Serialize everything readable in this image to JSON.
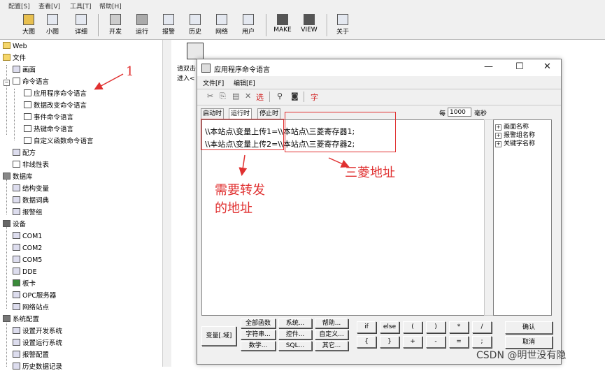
{
  "menubar": {
    "items": [
      "配置[S]",
      "查看[V]",
      "工具[T]",
      "帮助[H]"
    ]
  },
  "toolbar": {
    "buttons": [
      {
        "label": "大图",
        "icon": "large-icons-icon"
      },
      {
        "label": "小图",
        "icon": "small-icons-icon"
      },
      {
        "label": "详细",
        "icon": "details-icon"
      },
      {
        "label": "开发",
        "icon": "develop-icon"
      },
      {
        "label": "运行",
        "icon": "run-icon"
      },
      {
        "label": "报警",
        "icon": "alarm-icon"
      },
      {
        "label": "历史",
        "icon": "history-icon"
      },
      {
        "label": "网络",
        "icon": "network-icon"
      },
      {
        "label": "用户",
        "icon": "user-icon"
      },
      {
        "label": "MAKE",
        "icon": "make-icon"
      },
      {
        "label": "VIEW",
        "icon": "view-icon"
      },
      {
        "label": "关于",
        "icon": "about-icon"
      }
    ]
  },
  "tree": {
    "items": [
      {
        "label": "Web",
        "icon": "folder-icon"
      },
      {
        "label": "文件",
        "icon": "folder-icon"
      },
      {
        "label": "画面",
        "icon": "screen-icon"
      },
      {
        "label": "命令语言",
        "icon": "command-icon"
      },
      {
        "label": "应用程序命令语言",
        "icon": "script-icon"
      },
      {
        "label": "数据改变命令语言",
        "icon": "script-icon"
      },
      {
        "label": "事件命令语言",
        "icon": "script-icon"
      },
      {
        "label": "热键命令语言",
        "icon": "script-icon"
      },
      {
        "label": "自定义函数命令语言",
        "icon": "script-icon"
      },
      {
        "label": "配方",
        "icon": "recipe-icon"
      },
      {
        "label": "非线性表",
        "icon": "table-icon"
      },
      {
        "label": "数据库",
        "icon": "database-icon"
      },
      {
        "label": "结构变量",
        "icon": "struct-icon"
      },
      {
        "label": "数据词典",
        "icon": "dictionary-icon"
      },
      {
        "label": "报警组",
        "icon": "alarm-group-icon"
      },
      {
        "label": "设备",
        "icon": "device-icon"
      },
      {
        "label": "COM1",
        "icon": "port-icon"
      },
      {
        "label": "COM2",
        "icon": "port-icon"
      },
      {
        "label": "COM5",
        "icon": "port-icon"
      },
      {
        "label": "DDE",
        "icon": "dde-icon"
      },
      {
        "label": "板卡",
        "icon": "card-icon"
      },
      {
        "label": "OPC服务器",
        "icon": "opc-icon"
      },
      {
        "label": "网络站点",
        "icon": "network-station-icon"
      },
      {
        "label": "系统配置",
        "icon": "system-config-icon"
      },
      {
        "label": "设置开发系统",
        "icon": "settings-icon"
      },
      {
        "label": "设置运行系统",
        "icon": "settings-icon"
      },
      {
        "label": "报警配置",
        "icon": "alarm-config-icon"
      },
      {
        "label": "历史数据记录",
        "icon": "history-record-icon"
      }
    ]
  },
  "background_text": {
    "line1": "请双击",
    "line2": "进入<"
  },
  "dialog": {
    "title": "应用程序命令语言",
    "menu": [
      "文件[F]",
      "编辑[E]"
    ],
    "tool_select": "选",
    "tool_font": "字",
    "tabs": [
      "启动时",
      "运行时",
      "停止时"
    ],
    "every_label": "每",
    "interval_value": "1000",
    "interval_unit": "毫秒",
    "code_lines": [
      "\\\\本站点\\变量上传1=\\\\本站点\\三菱寄存器1;",
      "\\\\本站点\\变量上传2=\\\\本站点\\三菱寄存器2;"
    ],
    "right_list": [
      "画面名称",
      "报警组名称",
      "关键字名称"
    ],
    "bottom_buttons": {
      "variable": "变量[.域]",
      "all_functions": "全部函数",
      "system": "系统...",
      "help": "帮助...",
      "string": "字符串...",
      "control": "控件...",
      "custom": "自定义...",
      "math": "数学...",
      "sql": "SQL...",
      "other": "其它..."
    },
    "operators_row1": [
      "if",
      "else",
      "(",
      ")",
      "*",
      "/"
    ],
    "operators_row2": [
      "{",
      "}",
      "+",
      "-",
      "=",
      ";"
    ],
    "ok": "确认",
    "cancel": "取消"
  },
  "annotations": {
    "number": "1",
    "needs_forward": "需要转发",
    "address_of": "的地址",
    "mitsubishi_address": "三菱地址"
  },
  "watermark": "CSDN @明世没有隐",
  "colors": {
    "annotation_red": "#e03030",
    "chrome_gray": "#f0f0f0"
  }
}
